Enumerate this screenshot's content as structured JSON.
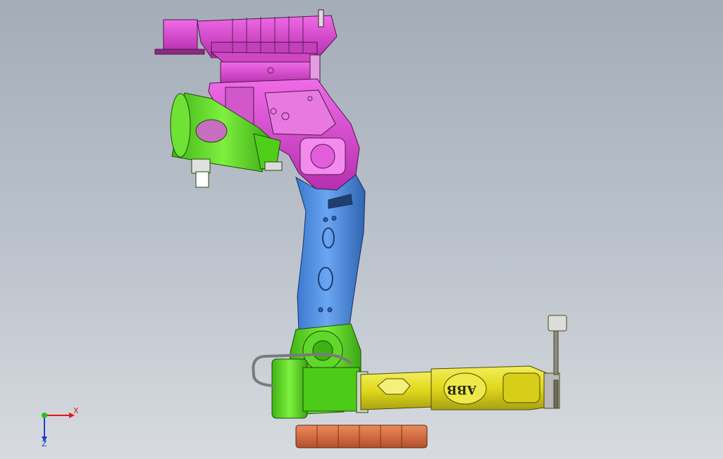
{
  "viewport": {
    "background_top": "#a4acb8",
    "background_bottom": "#d7dbe0"
  },
  "model": {
    "parts": [
      {
        "name": "base",
        "color": "#e04fd6"
      },
      {
        "name": "axis1-motor",
        "color": "#57e31e"
      },
      {
        "name": "lower-arm",
        "color": "#4d8fe8"
      },
      {
        "name": "axis3-housing",
        "color": "#57e31e"
      },
      {
        "name": "upper-arm",
        "color": "#e6e01c"
      },
      {
        "name": "counterweight",
        "color": "#d7683e"
      }
    ],
    "logo": "ABB"
  },
  "triad": {
    "x_label": "X",
    "z_label": "Z",
    "x_color": "#e01818",
    "y_color": "#25c025",
    "z_color": "#1a3fd0"
  }
}
